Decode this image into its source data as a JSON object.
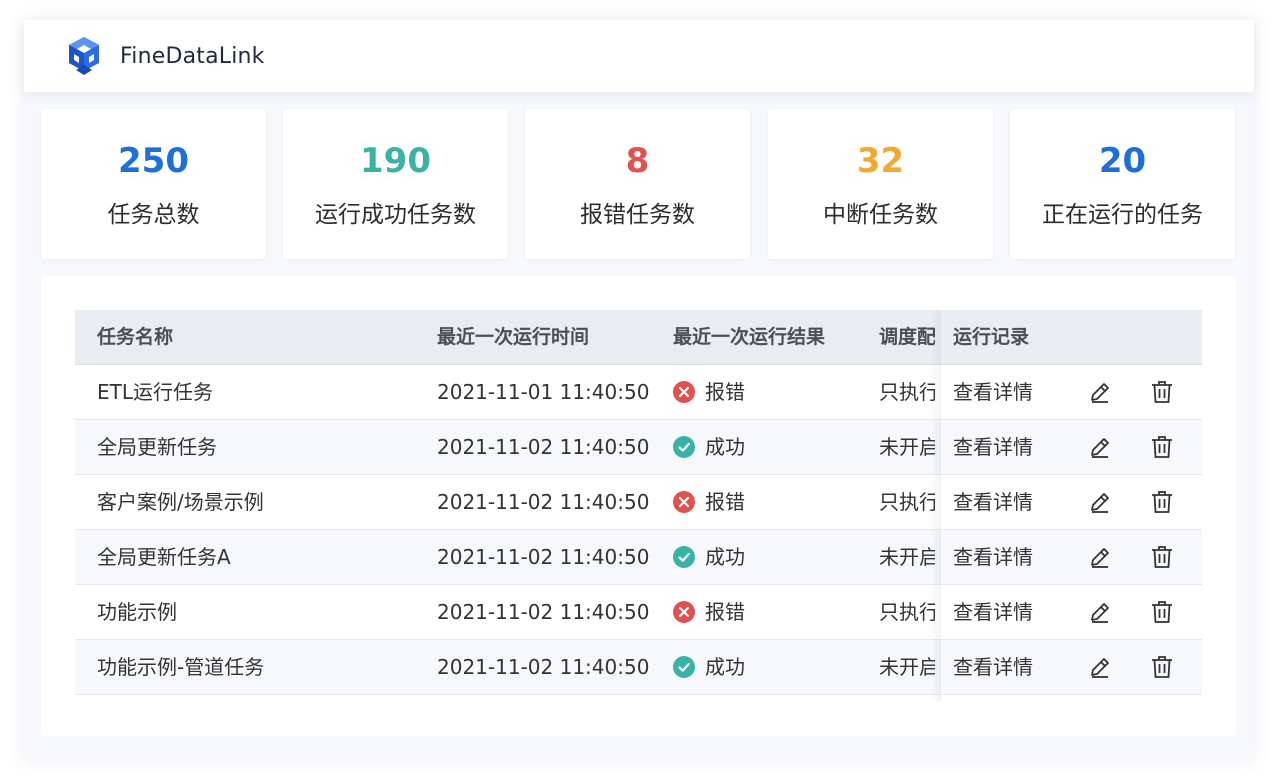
{
  "app": {
    "title": "FineDataLink",
    "logo_icon": "cube-logo-icon"
  },
  "stats": [
    {
      "value": "250",
      "label": "任务总数",
      "color": "#1e6fd9"
    },
    {
      "value": "190",
      "label": "运行成功任务数",
      "color": "#3bb3a4"
    },
    {
      "value": "8",
      "label": "报错任务数",
      "color": "#e2504f"
    },
    {
      "value": "32",
      "label": "中断任务数",
      "color": "#f3a92d"
    },
    {
      "value": "20",
      "label": "正在运行的任务",
      "color": "#1e6fd9"
    }
  ],
  "table": {
    "headers": {
      "name": "任务名称",
      "time": "最近一次运行时间",
      "result": "最近一次运行结果",
      "schedule": "调度配",
      "record": "运行记录"
    },
    "rows": [
      {
        "name": "ETL运行任务",
        "time": "2021-11-01 11:40:50",
        "result": "报错",
        "status": "error",
        "schedule": "只执行",
        "record": "查看详情"
      },
      {
        "name": "全局更新任务",
        "time": "2021-11-02 11:40:50",
        "result": "成功",
        "status": "success",
        "schedule": "未开启",
        "record": "查看详情"
      },
      {
        "name": "客户案例/场景示例",
        "time": "2021-11-02 11:40:50",
        "result": "报错",
        "status": "error",
        "schedule": "只执行",
        "record": "查看详情"
      },
      {
        "name": "全局更新任务A",
        "time": "2021-11-02 11:40:50",
        "result": "成功",
        "status": "success",
        "schedule": "未开启",
        "record": "查看详情"
      },
      {
        "name": "功能示例",
        "time": "2021-11-02 11:40:50",
        "result": "报错",
        "status": "error",
        "schedule": "只执行",
        "record": "查看详情"
      },
      {
        "name": "功能示例-管道任务",
        "time": "2021-11-02 11:40:50",
        "result": "成功",
        "status": "success",
        "schedule": "未开启",
        "record": "查看详情"
      }
    ],
    "icons": {
      "edit": "edit-pencil-icon",
      "delete": "trash-icon",
      "error": "error-x-icon",
      "success": "success-check-icon"
    }
  },
  "colors": {
    "link": "#3c78d8",
    "error": "#e2504f",
    "success": "#3bb3a4",
    "header_bg": "#e9edf2"
  }
}
